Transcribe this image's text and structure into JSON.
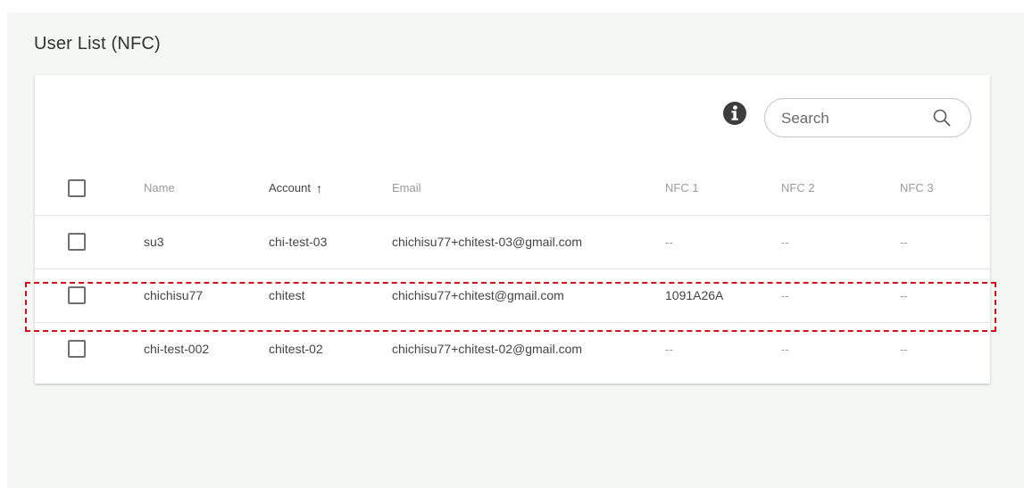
{
  "page": {
    "title": "User List (NFC)"
  },
  "toolbar": {
    "info_icon": "info-circle-icon",
    "search": {
      "placeholder": "Search",
      "value": "",
      "icon": "search-icon"
    }
  },
  "table": {
    "columns": {
      "name": "Name",
      "account": "Account",
      "email": "Email",
      "nfc1": "NFC 1",
      "nfc2": "NFC 2",
      "nfc3": "NFC 3"
    },
    "sort": {
      "column": "account",
      "direction": "ascending",
      "indicator": "↑"
    },
    "rows": [
      {
        "name": "su3",
        "account": "chi-test-03",
        "email": "chichisu77+chitest-03@gmail.com",
        "nfc1": "--",
        "nfc2": "--",
        "nfc3": "--",
        "selected": false
      },
      {
        "name": "chichisu77",
        "account": "chitest",
        "email": "chichisu77+chitest@gmail.com",
        "nfc1": "1091A26A",
        "nfc2": "--",
        "nfc3": "--",
        "selected": false
      },
      {
        "name": "chi-test-002",
        "account": "chitest-02",
        "email": "chichisu77+chitest-02@gmail.com",
        "nfc1": "--",
        "nfc2": "--",
        "nfc3": "--",
        "selected": false
      }
    ]
  },
  "annotation": {
    "highlighted_row": 1,
    "color": "#d0101a"
  },
  "colors": {
    "page_background": "#f4f7f3",
    "card_background": "#ffffff",
    "header_text": "#9a9a9a"
  }
}
